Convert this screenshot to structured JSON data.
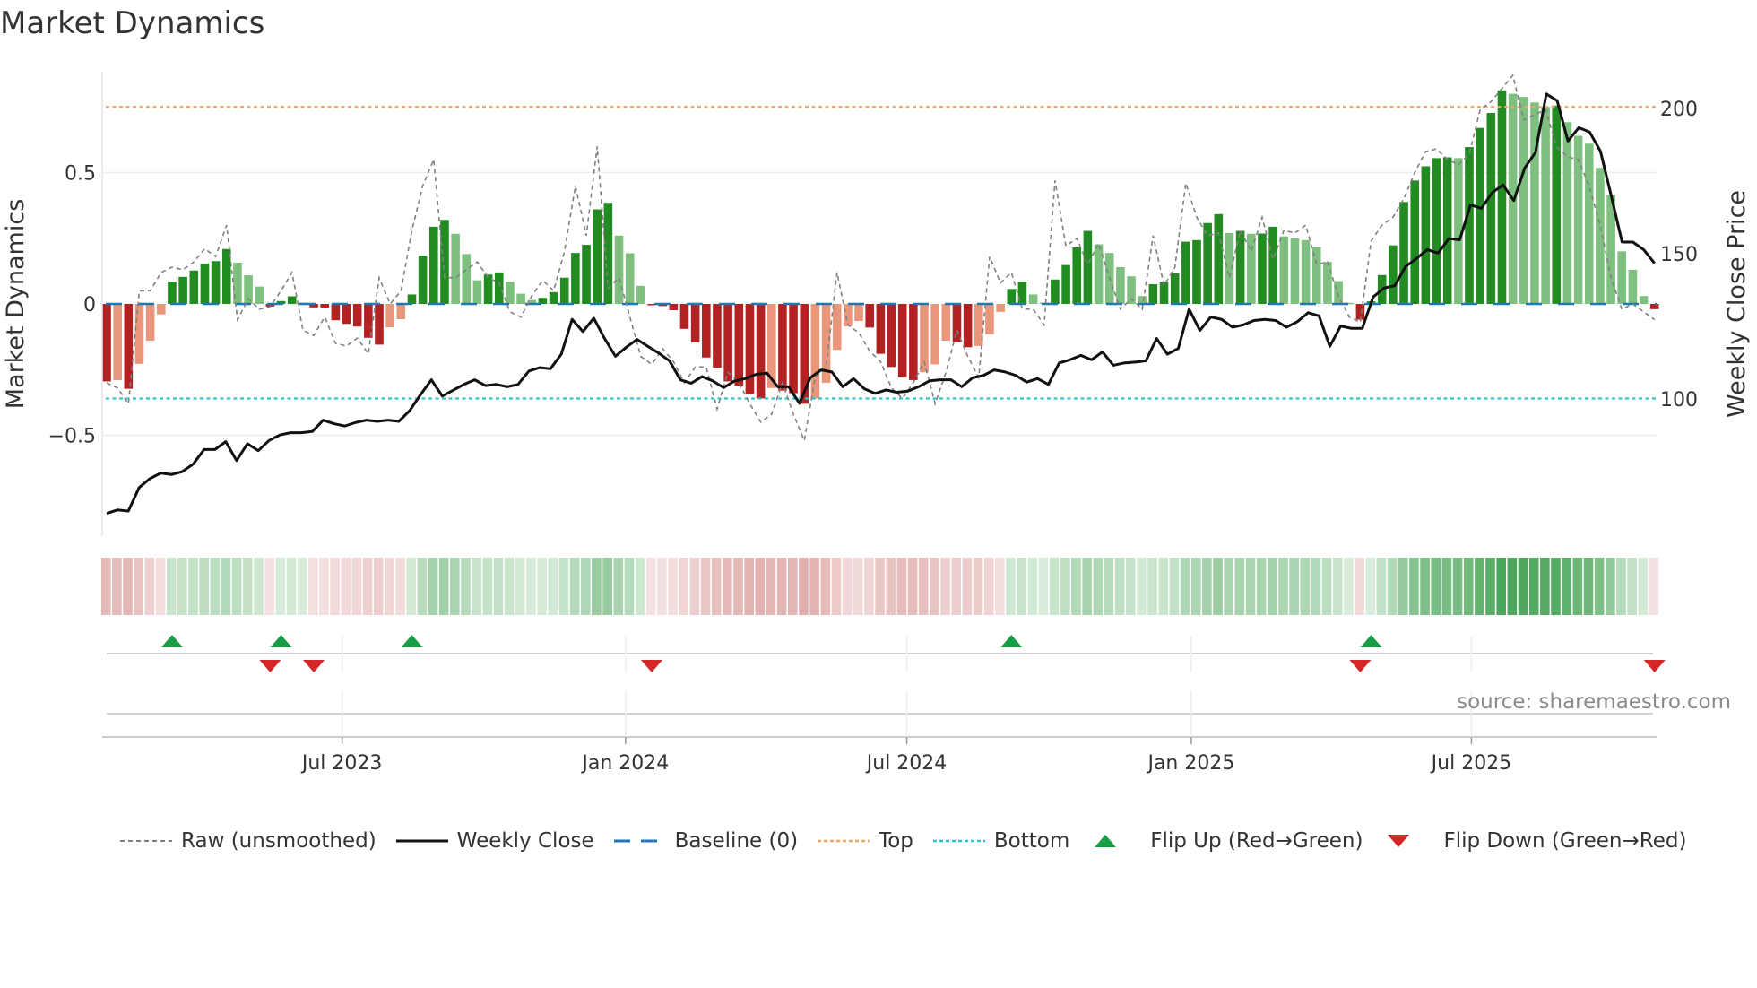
{
  "title": "Market Dynamics",
  "source": "source: sharemaestro.com",
  "colors": {
    "pos_rising": "#228b22",
    "pos_falling": "#7fbf7f",
    "neg_falling": "#b22222",
    "neg_rising": "#e9967a",
    "raw": "#808080",
    "close": "#111111",
    "baseline": "#1f77b4",
    "top": "#f4a460",
    "bottom": "#2ec4d4",
    "flip_up": "#1a9e45",
    "flip_down": "#d62728",
    "strip_green": "#3a9e4a",
    "strip_red": "#c96a6a"
  },
  "legend": [
    {
      "label": "Raw (unsmoothed)",
      "icon": "dashed-gray-line"
    },
    {
      "label": "Weekly Close",
      "icon": "solid-black-line"
    },
    {
      "label": "Baseline (0)",
      "icon": "dashed-blue-line"
    },
    {
      "label": "Top",
      "icon": "dotted-orange-line"
    },
    {
      "label": "Bottom",
      "icon": "dotted-cyan-line"
    },
    {
      "label": "Flip Up (Red→Green)",
      "icon": "triangle-up-green"
    },
    {
      "label": "Flip Down (Green→Red)",
      "icon": "triangle-down-red"
    }
  ],
  "chart_data": {
    "type": "bar",
    "title": "Market Dynamics",
    "ylabel": "Market Dynamics",
    "y2label": "Weekly Close Price",
    "x_unit": "week index (weekly bars)",
    "ylim": [
      -0.88,
      0.93
    ],
    "y_ticks": [
      {
        "v": 0.5,
        "label": "0.5"
      },
      {
        "v": 0,
        "label": "0"
      },
      {
        "v": -0.5,
        "label": "−0.5"
      }
    ],
    "y2_ticks": [
      {
        "v": 200,
        "label": "200"
      },
      {
        "v": 150,
        "label": "150"
      },
      {
        "v": 100,
        "label": "100"
      }
    ],
    "x_ticks": [
      {
        "week_index": 21.6,
        "label": "Jul 2023"
      },
      {
        "week_index": 47.6,
        "label": "Jan 2024"
      },
      {
        "week_index": 73.4,
        "label": "Jul 2024"
      },
      {
        "week_index": 99.5,
        "label": "Jan 2025"
      },
      {
        "week_index": 125.2,
        "label": "Jul 2025"
      }
    ],
    "top_level": 0.75,
    "bottom_level": -0.36,
    "baseline": 0,
    "momentum": [
      -0.295,
      -0.29,
      -0.323,
      -0.228,
      -0.14,
      -0.04,
      0.085,
      0.103,
      0.127,
      0.154,
      0.163,
      0.209,
      0.157,
      0.109,
      0.066,
      -0.01,
      0.011,
      0.029,
      0.005,
      -0.013,
      -0.014,
      -0.062,
      -0.076,
      -0.086,
      -0.129,
      -0.155,
      -0.089,
      -0.058,
      0.036,
      0.184,
      0.294,
      0.32,
      0.267,
      0.19,
      0.09,
      0.112,
      0.12,
      0.084,
      0.039,
      0.015,
      0.023,
      0.045,
      0.1,
      0.194,
      0.225,
      0.36,
      0.385,
      0.26,
      0.193,
      0.069,
      -0.003,
      -0.008,
      -0.024,
      -0.095,
      -0.147,
      -0.204,
      -0.243,
      -0.295,
      -0.313,
      -0.343,
      -0.36,
      -0.32,
      -0.33,
      -0.34,
      -0.38,
      -0.36,
      -0.3,
      -0.175,
      -0.085,
      -0.065,
      -0.09,
      -0.19,
      -0.24,
      -0.28,
      -0.29,
      -0.26,
      -0.23,
      -0.14,
      -0.145,
      -0.165,
      -0.16,
      -0.115,
      -0.03,
      0.057,
      0.085,
      0.036,
      0.005,
      0.093,
      0.148,
      0.215,
      0.278,
      0.227,
      0.194,
      0.14,
      0.105,
      0.03,
      0.075,
      0.084,
      0.116,
      0.237,
      0.243,
      0.308,
      0.342,
      0.27,
      0.278,
      0.267,
      0.268,
      0.294,
      0.257,
      0.249,
      0.243,
      0.217,
      0.16,
      0.087,
      0.004,
      -0.06,
      0.01,
      0.11,
      0.223,
      0.388,
      0.47,
      0.524,
      0.555,
      0.558,
      0.555,
      0.597,
      0.67,
      0.727,
      0.813,
      0.8,
      0.788,
      0.767,
      0.75,
      0.755,
      0.692,
      0.64,
      0.61,
      0.518,
      0.415,
      0.2,
      0.13,
      0.03,
      -0.02
    ],
    "raw": [
      -0.3,
      -0.32,
      -0.38,
      0.05,
      0.05,
      0.12,
      0.14,
      0.13,
      0.16,
      0.21,
      0.18,
      0.3,
      -0.06,
      0.02,
      -0.02,
      -0.01,
      0.05,
      0.12,
      -0.1,
      -0.12,
      -0.05,
      -0.15,
      -0.16,
      -0.13,
      -0.19,
      0.1,
      0.0,
      0.05,
      0.28,
      0.45,
      0.55,
      0.1,
      0.1,
      0.13,
      0.16,
      0.1,
      0.08,
      -0.03,
      -0.05,
      0.03,
      0.09,
      0.05,
      0.2,
      0.45,
      0.26,
      0.6,
      0.06,
      0.1,
      -0.05,
      -0.2,
      -0.23,
      -0.17,
      -0.22,
      -0.3,
      -0.24,
      -0.24,
      -0.4,
      -0.26,
      -0.3,
      -0.38,
      -0.45,
      -0.42,
      -0.3,
      -0.42,
      -0.52,
      -0.28,
      -0.24,
      0.12,
      -0.08,
      -0.11,
      -0.18,
      -0.22,
      -0.32,
      -0.36,
      -0.3,
      -0.22,
      -0.38,
      -0.26,
      -0.1,
      -0.2,
      -0.28,
      0.18,
      0.08,
      0.12,
      -0.02,
      -0.02,
      -0.08,
      0.47,
      0.22,
      0.25,
      0.15,
      0.23,
      0.1,
      -0.02,
      0.02,
      -0.02,
      0.26,
      0.07,
      0.14,
      0.46,
      0.33,
      0.26,
      0.27,
      0.1,
      0.28,
      0.2,
      0.33,
      0.17,
      0.28,
      0.27,
      0.3,
      0.15,
      0.16,
      0.03,
      -0.05,
      -0.07,
      0.24,
      0.3,
      0.33,
      0.4,
      0.5,
      0.58,
      0.59,
      0.55,
      0.53,
      0.57,
      0.74,
      0.77,
      0.82,
      0.87,
      0.7,
      0.72,
      0.74,
      0.6,
      0.56,
      0.55,
      0.45,
      0.3,
      0.1,
      -0.02,
      0.0,
      -0.03,
      -0.06
    ],
    "weekly_close": [
      60.6,
      61.8,
      61.4,
      69.5,
      72.6,
      74.5,
      74,
      75,
      77.6,
      82.6,
      82.6,
      85.3,
      78.8,
      84.6,
      82.2,
      85.7,
      87.6,
      88.4,
      88.4,
      88.8,
      92.7,
      91.5,
      90.7,
      91.9,
      92.7,
      92.3,
      92.7,
      92.3,
      96,
      101.5,
      106.6,
      101,
      103,
      105,
      106.6,
      104.6,
      105,
      104.2,
      105,
      109.6,
      110.8,
      110.4,
      115.4,
      127.4,
      123.2,
      127.8,
      120.8,
      114.7,
      117.8,
      120.5,
      118.1,
      115.8,
      113.1,
      106.6,
      105.4,
      107.7,
      106.2,
      103.9,
      106.2,
      107,
      108.5,
      108.9,
      104.2,
      104.2,
      98.5,
      107.3,
      110,
      109.3,
      104.2,
      107,
      103.5,
      101.9,
      103.1,
      102.3,
      102.7,
      104.2,
      106.2,
      106.6,
      106.6,
      104.2,
      107.3,
      108.1,
      110,
      109.3,
      108.1,
      105.8,
      107,
      105,
      112.4,
      113.5,
      115,
      113.5,
      116.2,
      111.6,
      112.4,
      112.7,
      113.1,
      120.8,
      115.4,
      117.4,
      130.9,
      123.6,
      128.2,
      127.4,
      124.7,
      125.5,
      127,
      127.4,
      127,
      124.7,
      126.6,
      129.7,
      128.6,
      118.1,
      125.1,
      124.3,
      124.3,
      135.1,
      138.2,
      139,
      145.6,
      148.3,
      151.4,
      150.2,
      155.2,
      154.8,
      166.8,
      165.6,
      171,
      173.7,
      168.3,
      179.5,
      184.9,
      205,
      202.7,
      188.8,
      193.4,
      191.9,
      185.3,
      169.9,
      154,
      154,
      151.4,
      146.7
    ]
  }
}
